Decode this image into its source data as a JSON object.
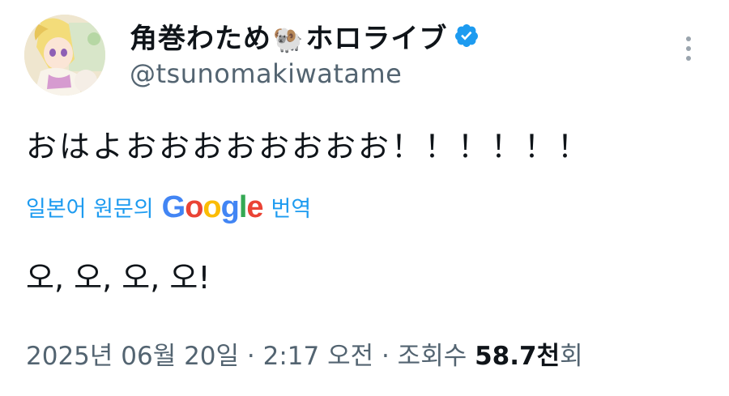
{
  "author": {
    "display_name": "角巻わため",
    "emoji": "🐏",
    "display_name_suffix": "ホロライブ",
    "handle": "@tsunomakiwatame",
    "verified_icon": "verified-badge-icon",
    "avatar_icon": "avatar"
  },
  "menu": {
    "more_icon": "more-vertical-icon"
  },
  "tweet": {
    "text": "おはよおおおおおおおお！！！！！！",
    "translate_prefix": "일본어 원문의",
    "translate_brand": [
      "G",
      "o",
      "o",
      "g",
      "l",
      "e"
    ],
    "translate_suffix": "번역",
    "translated_text": "오, 오, 오, 오!"
  },
  "meta": {
    "timestamp": "2025년 06월 20일 · 2:17 오전 · 조회수",
    "views_count": "58.7천",
    "views_suffix": "회"
  },
  "colors": {
    "link": "#1d9bf0",
    "secondary_text": "#536471",
    "primary_text": "#0f1419",
    "verified": "#1d9bf0"
  }
}
